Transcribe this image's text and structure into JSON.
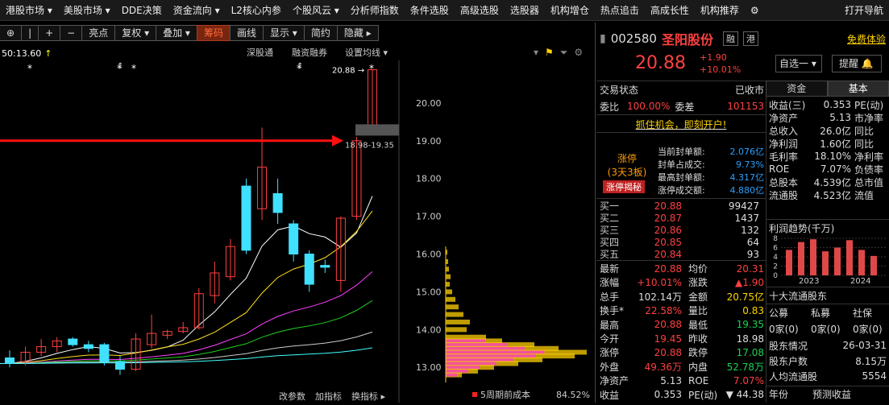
{
  "menubar": {
    "items": [
      "港股市场 ▾",
      "美股市场 ▾",
      "DDE决策",
      "资金流向 ▾",
      "L2核心内参",
      "个股风云 ▾",
      "分析师指数",
      "条件选股",
      "高级选股",
      "选股器",
      "机构增仓",
      "热点追击",
      "高成长性",
      "机构推荐",
      "⚙",
      "打开导航"
    ]
  },
  "toolbar": {
    "buttons": [
      "⊕",
      "|",
      "+",
      "−",
      "亮点",
      "复权 ▾",
      "叠加 ▾",
      "筹码",
      "画线",
      "显示 ▾",
      "简约",
      "隐藏 ▸"
    ],
    "active": "筹码"
  },
  "infobar": {
    "ma_text": "50:13.60",
    "links": [
      "深股通",
      "融资融券",
      "设置均线 ▾"
    ]
  },
  "chart_data": {
    "type": "candlestick",
    "y_ticks": [
      "20.00",
      "19.00",
      "18.00",
      "17.00",
      "16.00",
      "15.00",
      "14.00",
      "13.00"
    ],
    "ylim": [
      12.6,
      21.0
    ],
    "high_label": "20.88",
    "range_label": "18.98-19.35",
    "candles": [
      {
        "o": 13.25,
        "h": 13.45,
        "l": 13.0,
        "c": 13.1
      },
      {
        "o": 13.15,
        "h": 13.55,
        "l": 13.05,
        "c": 13.4
      },
      {
        "o": 13.4,
        "h": 13.75,
        "l": 13.3,
        "c": 13.55
      },
      {
        "o": 13.55,
        "h": 13.8,
        "l": 13.4,
        "c": 13.7
      },
      {
        "o": 13.75,
        "h": 13.8,
        "l": 13.55,
        "c": 13.6
      },
      {
        "o": 13.6,
        "h": 13.7,
        "l": 13.4,
        "c": 13.5
      },
      {
        "o": 13.6,
        "h": 13.65,
        "l": 13.05,
        "c": 13.15
      },
      {
        "o": 13.15,
        "h": 13.3,
        "l": 12.8,
        "c": 12.95
      },
      {
        "o": 12.95,
        "h": 13.9,
        "l": 12.9,
        "c": 13.75
      },
      {
        "o": 13.6,
        "h": 14.4,
        "l": 13.5,
        "c": 13.9
      },
      {
        "o": 13.85,
        "h": 14.0,
        "l": 13.75,
        "c": 13.95
      },
      {
        "o": 13.95,
        "h": 14.2,
        "l": 13.9,
        "c": 14.05
      },
      {
        "o": 14.05,
        "h": 15.1,
        "l": 14.0,
        "c": 14.95
      },
      {
        "o": 14.9,
        "h": 15.8,
        "l": 14.7,
        "c": 15.5
      },
      {
        "o": 15.4,
        "h": 16.4,
        "l": 15.3,
        "c": 16.2
      },
      {
        "o": 17.8,
        "h": 18.0,
        "l": 16.0,
        "c": 16.1
      },
      {
        "o": 17.2,
        "h": 19.35,
        "l": 16.9,
        "c": 18.3
      },
      {
        "o": 17.6,
        "h": 18.0,
        "l": 16.8,
        "c": 17.1
      },
      {
        "o": 16.8,
        "h": 16.9,
        "l": 15.8,
        "c": 16.0
      },
      {
        "o": 16.0,
        "h": 16.1,
        "l": 15.0,
        "c": 15.2
      },
      {
        "o": 15.7,
        "h": 15.85,
        "l": 15.5,
        "c": 15.65
      },
      {
        "o": 15.3,
        "h": 17.0,
        "l": 15.0,
        "c": 16.95
      },
      {
        "o": 17.0,
        "h": 19.1,
        "l": 16.9,
        "c": 19.0
      },
      {
        "o": 19.35,
        "h": 20.88,
        "l": 19.35,
        "c": 20.88
      }
    ],
    "ma_colors": [
      "#ffffff",
      "#ffe020",
      "#ff40ff",
      "#20d020",
      "#cccccc",
      "#40ffff"
    ],
    "bottom_labels": [
      "改参数",
      "加指标",
      "换指标 ▸",
      "5周期前成本",
      "84.52%"
    ]
  },
  "quote": {
    "code": "002580",
    "name": "圣阳股份",
    "badges": [
      "融",
      "港"
    ],
    "free_link": "免费体验",
    "price": "20.88",
    "change": "+1.90",
    "change_pct": "+10.01%",
    "select_btn": "自选一 ▾",
    "alert_btn": "提醒 🔔",
    "status_label": "交易状态",
    "status_value": "已收市",
    "wb_label": "委比",
    "wb_value": "100.00%",
    "wc_label": "委差",
    "wc_value": "101153",
    "promo": "抓住机会，即刻开户!",
    "limit": {
      "title": "涨停",
      "sub": "(3天3板)",
      "btn": "涨停揭秘",
      "rows": [
        [
          "最高封单额:",
          "2.076亿"
        ],
        [
          "封单占成交:",
          "9.73%"
        ],
        [
          "最高封单额:",
          "4.317亿"
        ],
        [
          "涨停成交额:",
          "4.880亿"
        ]
      ],
      "row_labels_text": [
        "当前封单额:",
        "封单占成交:",
        "最高封单额:",
        "涨停成交额:"
      ]
    },
    "bids": [
      [
        "买一",
        "20.88",
        "99427"
      ],
      [
        "买二",
        "20.87",
        "1437"
      ],
      [
        "买三",
        "20.86",
        "132"
      ],
      [
        "买四",
        "20.85",
        "64"
      ],
      [
        "买五",
        "20.84",
        "93"
      ]
    ],
    "stats": [
      [
        "最新",
        "20.88",
        "均价",
        "20.31"
      ],
      [
        "涨幅",
        "+10.01%",
        "涨跌",
        "▲1.90"
      ],
      [
        "总手",
        "102.14万",
        "金额",
        "20.75亿"
      ],
      [
        "换手*",
        "22.58%",
        "量比",
        "0.83"
      ],
      [
        "最高",
        "20.88",
        "最低",
        "19.35"
      ],
      [
        "今开",
        "19.45",
        "昨收",
        "18.98"
      ],
      [
        "涨停",
        "20.88",
        "跌停",
        "17.08"
      ],
      [
        "外盘",
        "49.36万",
        "内盘",
        "52.78万"
      ],
      [
        "净资产",
        "5.13",
        "ROE",
        "7.07%"
      ],
      [
        "收益",
        "0.353",
        "PE(动)",
        "▼ 44.38"
      ]
    ]
  },
  "right": {
    "tabs": [
      "资金",
      "基本"
    ],
    "fund": [
      [
        "收益(三)",
        "0.353",
        "PE(动)"
      ],
      [
        "净资产",
        "5.13",
        "市净率"
      ],
      [
        "总收入",
        "26.0亿",
        "同比"
      ],
      [
        "净利润",
        "1.60亿",
        "同比"
      ],
      [
        "毛利率",
        "18.10%",
        "净利率"
      ],
      [
        "ROE",
        "7.07%",
        "负债率"
      ],
      [
        "总股本",
        "4.539亿",
        "总市值"
      ],
      [
        "流通股",
        "4.523亿",
        "流值"
      ]
    ],
    "profit_title": "利润趋势(千万)",
    "profit_yticks": [
      "8",
      "6",
      "4",
      "2",
      "0"
    ],
    "profit_years": [
      "2023",
      "2024"
    ],
    "profit_bars": [
      5.5,
      7.2,
      7.8,
      5.2,
      6.0,
      7.6,
      5.5,
      4.2
    ],
    "holders_title": "十大流通股东",
    "holder_types": [
      "公募",
      "私募",
      "社保"
    ],
    "holder_values": [
      "0家(0)",
      "0家(0)",
      "0家(0)"
    ],
    "info": [
      [
        "股东情况",
        "26-03-31"
      ],
      [
        "股东户数",
        "8.15万"
      ],
      [
        "人均流通股",
        "5554"
      ]
    ],
    "bottom": [
      "年份",
      "预测收益"
    ]
  }
}
